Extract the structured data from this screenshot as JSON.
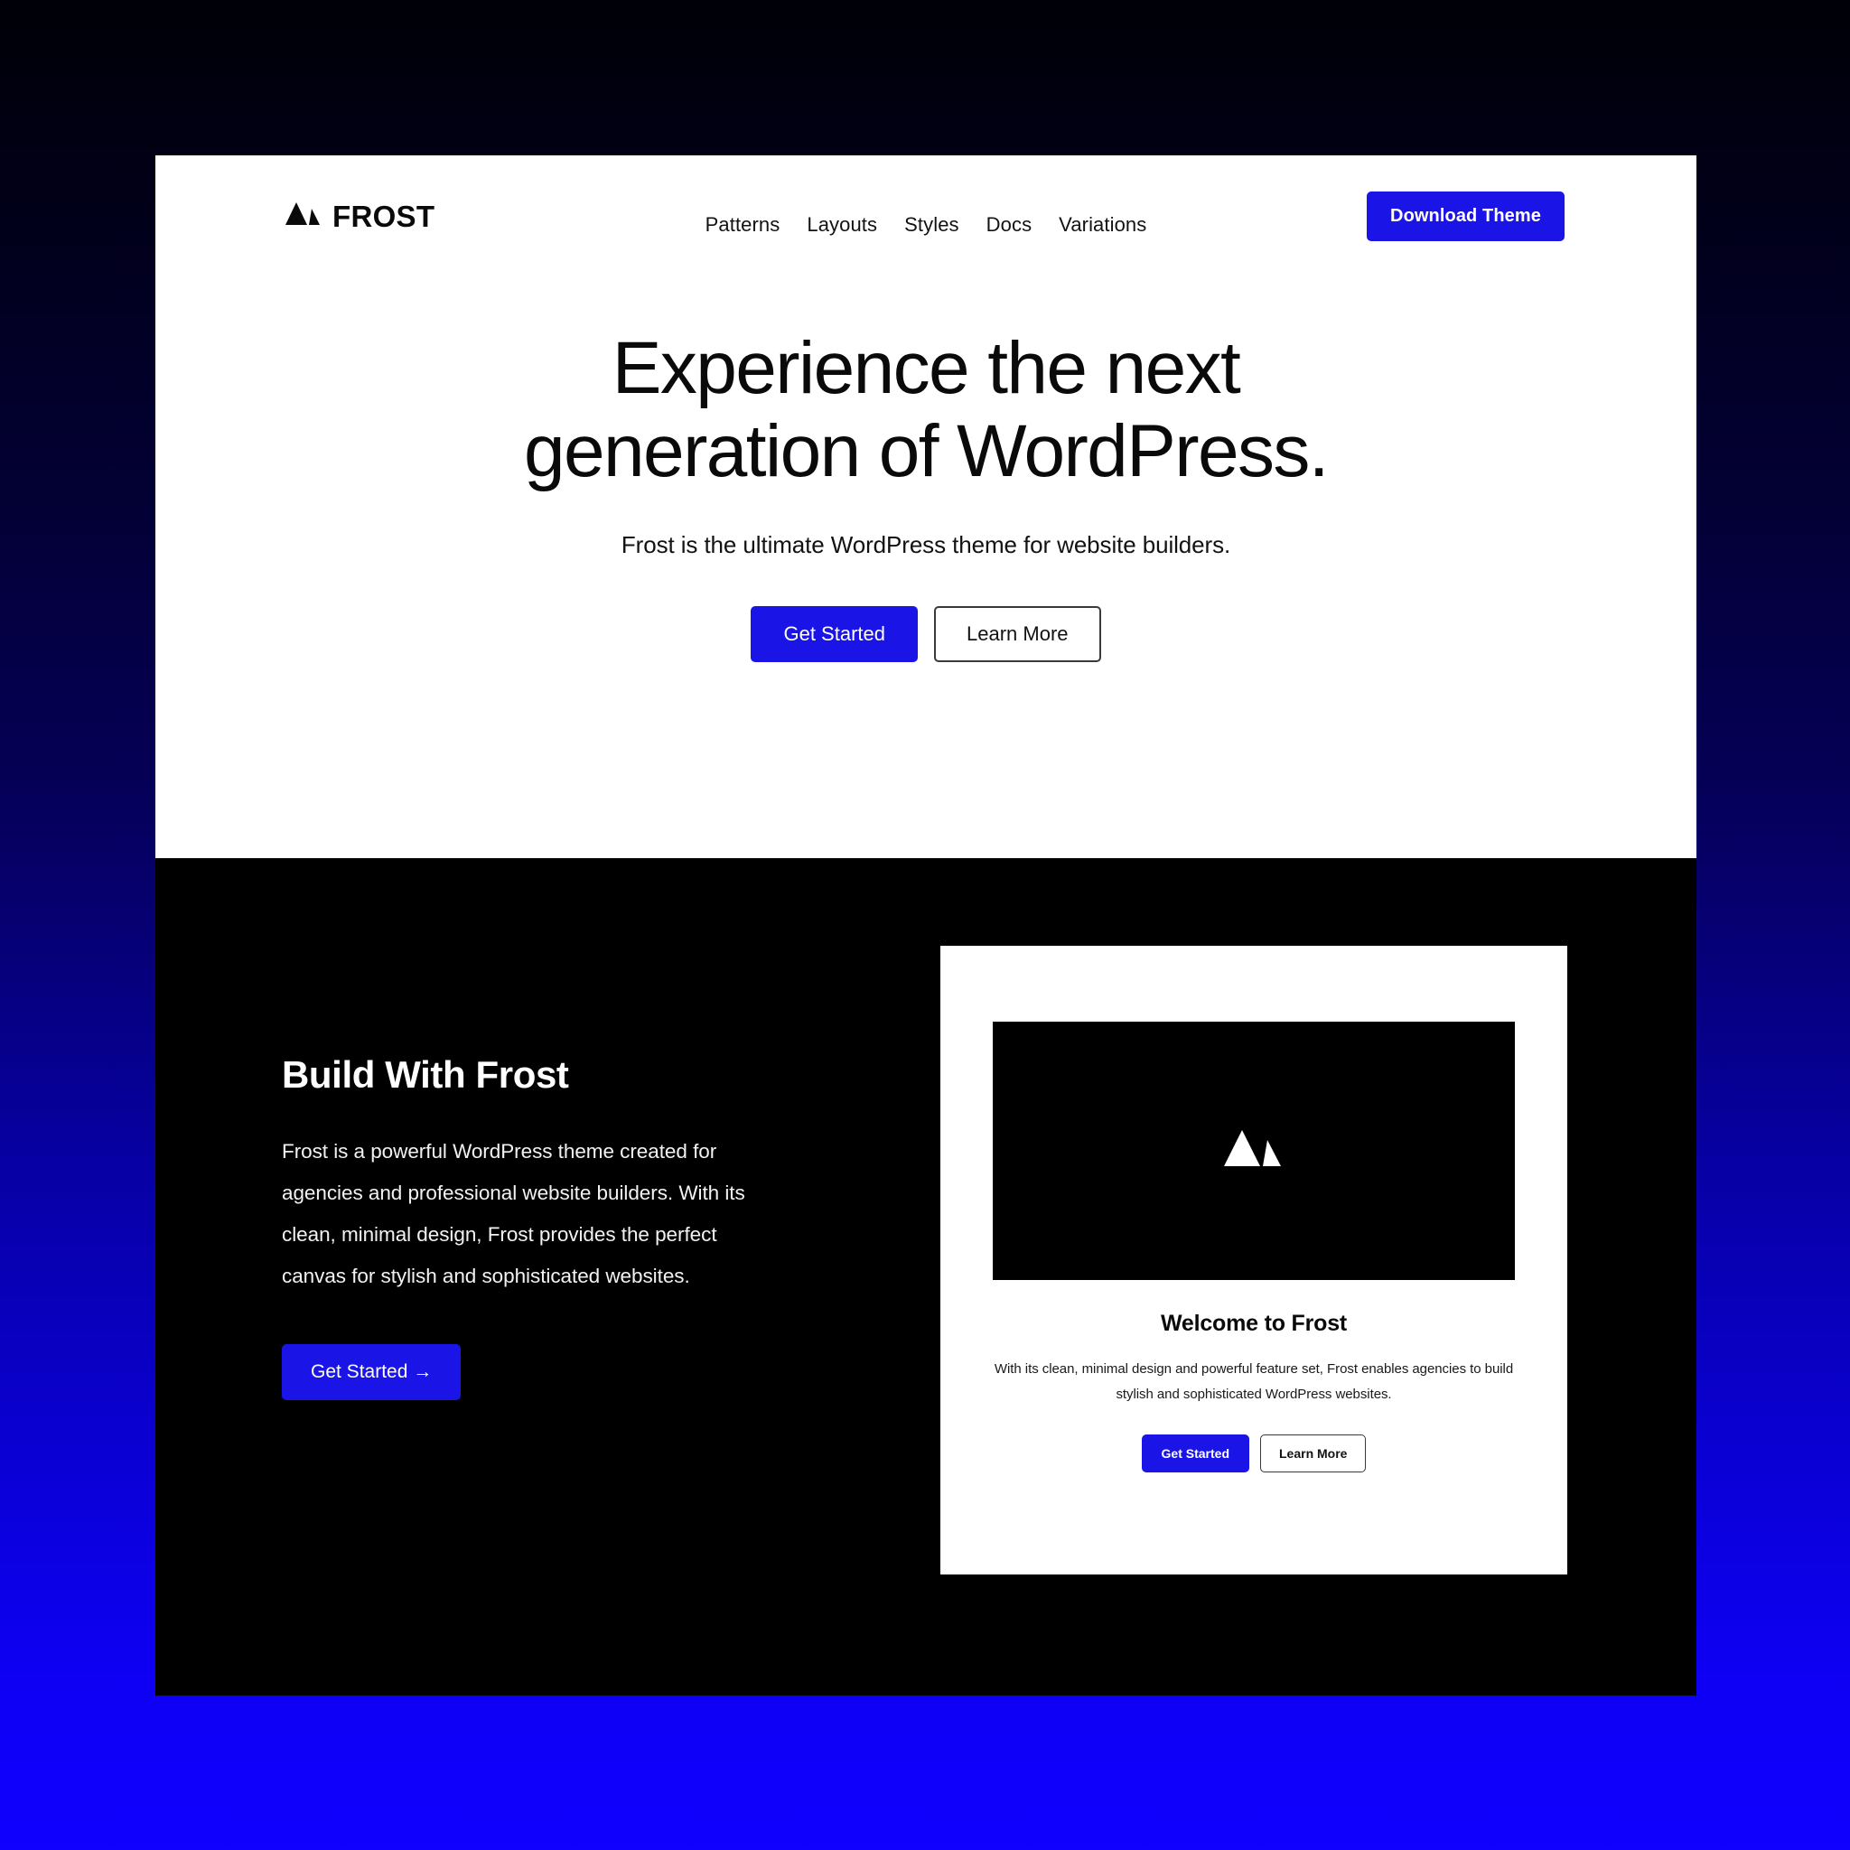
{
  "brand": {
    "name": "FROST",
    "logo_icon": "mountain-icon"
  },
  "nav": {
    "items": [
      {
        "label": "Patterns"
      },
      {
        "label": "Layouts"
      },
      {
        "label": "Styles"
      },
      {
        "label": "Docs"
      },
      {
        "label": "Variations"
      }
    ],
    "cta_label": "Download Theme"
  },
  "hero": {
    "title": "Experience the next generation of WordPress.",
    "subtitle": "Frost is the ultimate WordPress theme for website builders.",
    "primary_label": "Get Started",
    "secondary_label": "Learn More"
  },
  "build": {
    "title": "Build With Frost",
    "body": "Frost is a powerful WordPress theme created for agencies and professional website builders. With its clean, minimal design, Frost provides the perfect canvas for stylish and sophisticated websites.",
    "cta_label": "Get Started →"
  },
  "preview_card": {
    "image_icon": "mountain-icon",
    "heading": "Welcome to Frost",
    "text": "With its clean, minimal design and powerful feature set, Frost enables agencies to build stylish and sophisticated WordPress websites.",
    "primary_label": "Get Started",
    "secondary_label": "Learn More"
  },
  "colors": {
    "accent_blue": "#1a14e6",
    "page_white": "#ffffff",
    "section_black": "#000000",
    "backdrop_top": "#000007",
    "backdrop_bottom": "#0f00ff",
    "text_dark": "#0a0a0a",
    "text_light": "#ffffff",
    "outline_border": "#3a3a3a"
  }
}
